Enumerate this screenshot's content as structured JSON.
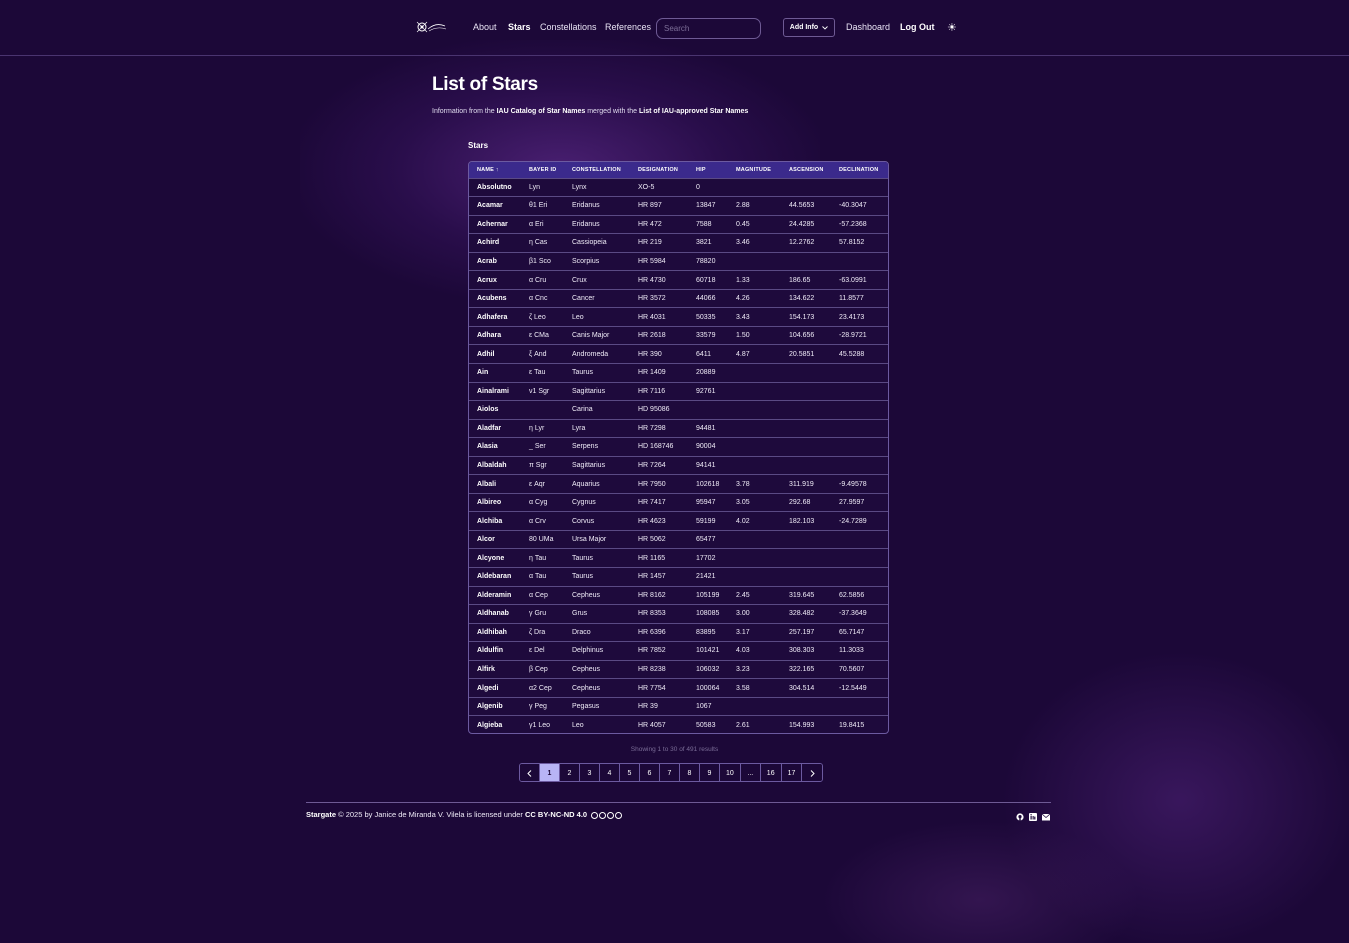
{
  "nav": {
    "logo_text": "Stargate",
    "links": [
      "About",
      "Stars",
      "Constellations",
      "References"
    ],
    "active": "Stars",
    "search_placeholder": "Search",
    "add_info": "Add Info",
    "dashboard": "Dashboard",
    "logout": "Log Out",
    "theme_icon": "sun-icon"
  },
  "page": {
    "title": "List of Stars",
    "info_prefix": "Information from the ",
    "info_source1": "IAU Catalog of Star Names",
    "info_mid": " merged with the ",
    "info_source2": "List of IAU-approved Star Names",
    "section": "Stars"
  },
  "table": {
    "headers": [
      "NAME ↑",
      "BAYER ID",
      "CONSTELLATION",
      "DESIGNATION",
      "HIP",
      "MAGNITUDE",
      "ASCENSION",
      "DECLINATION"
    ],
    "rows": [
      [
        "Absolutno",
        "Lyn",
        "Lynx",
        "XO-5",
        "0",
        "",
        "",
        ""
      ],
      [
        "Acamar",
        "θ1 Eri",
        "Eridanus",
        "HR 897",
        "13847",
        "2.88",
        "44.5653",
        "-40.3047"
      ],
      [
        "Achernar",
        "α Eri",
        "Eridanus",
        "HR 472",
        "7588",
        "0.45",
        "24.4285",
        "-57.2368"
      ],
      [
        "Achird",
        "η Cas",
        "Cassiopeia",
        "HR 219",
        "3821",
        "3.46",
        "12.2762",
        "57.8152"
      ],
      [
        "Acrab",
        "β1 Sco",
        "Scorpius",
        "HR 5984",
        "78820",
        "",
        "",
        ""
      ],
      [
        "Acrux",
        "α Cru",
        "Crux",
        "HR 4730",
        "60718",
        "1.33",
        "186.65",
        "-63.0991"
      ],
      [
        "Acubens",
        "α Cnc",
        "Cancer",
        "HR 3572",
        "44066",
        "4.26",
        "134.622",
        "11.8577"
      ],
      [
        "Adhafera",
        "ζ Leo",
        "Leo",
        "HR 4031",
        "50335",
        "3.43",
        "154.173",
        "23.4173"
      ],
      [
        "Adhara",
        "ε CMa",
        "Canis Major",
        "HR 2618",
        "33579",
        "1.50",
        "104.656",
        "-28.9721"
      ],
      [
        "Adhil",
        "ξ And",
        "Andromeda",
        "HR 390",
        "6411",
        "4.87",
        "20.5851",
        "45.5288"
      ],
      [
        "Ain",
        "ε Tau",
        "Taurus",
        "HR 1409",
        "20889",
        "",
        "",
        ""
      ],
      [
        "Ainalrami",
        "ν1 Sgr",
        "Sagittarius",
        "HR 7116",
        "92761",
        "",
        "",
        ""
      ],
      [
        "Aiolos",
        "",
        "Carina",
        "HD 95086",
        "",
        "",
        "",
        ""
      ],
      [
        "Aladfar",
        "η Lyr",
        "Lyra",
        "HR 7298",
        "94481",
        "",
        "",
        ""
      ],
      [
        "Alasia",
        "_ Ser",
        "Serpens",
        "HD 168746",
        "90004",
        "",
        "",
        ""
      ],
      [
        "Albaldah",
        "π Sgr",
        "Sagittarius",
        "HR 7264",
        "94141",
        "",
        "",
        ""
      ],
      [
        "Albali",
        "ε Aqr",
        "Aquarius",
        "HR 7950",
        "102618",
        "3.78",
        "311.919",
        "-9.49578"
      ],
      [
        "Albireo",
        "α Cyg",
        "Cygnus",
        "HR 7417",
        "95947",
        "3.05",
        "292.68",
        "27.9597"
      ],
      [
        "Alchiba",
        "α Crv",
        "Corvus",
        "HR 4623",
        "59199",
        "4.02",
        "182.103",
        "-24.7289"
      ],
      [
        "Alcor",
        "80 UMa",
        "Ursa Major",
        "HR 5062",
        "65477",
        "",
        "",
        ""
      ],
      [
        "Alcyone",
        "η Tau",
        "Taurus",
        "HR 1165",
        "17702",
        "",
        "",
        ""
      ],
      [
        "Aldebaran",
        "α Tau",
        "Taurus",
        "HR 1457",
        "21421",
        "",
        "",
        ""
      ],
      [
        "Alderamin",
        "α Cep",
        "Cepheus",
        "HR 8162",
        "105199",
        "2.45",
        "319.645",
        "62.5856"
      ],
      [
        "Aldhanab",
        "γ Gru",
        "Grus",
        "HR 8353",
        "108085",
        "3.00",
        "328.482",
        "-37.3649"
      ],
      [
        "Aldhibah",
        "ζ Dra",
        "Draco",
        "HR 6396",
        "83895",
        "3.17",
        "257.197",
        "65.7147"
      ],
      [
        "Aldulfin",
        "ε Del",
        "Delphinus",
        "HR 7852",
        "101421",
        "4.03",
        "308.303",
        "11.3033"
      ],
      [
        "Alfirk",
        "β Cep",
        "Cepheus",
        "HR 8238",
        "106032",
        "3.23",
        "322.165",
        "70.5607"
      ],
      [
        "Algedi",
        "α2 Cep",
        "Cepheus",
        "HR 7754",
        "100064",
        "3.58",
        "304.514",
        "-12.5449"
      ],
      [
        "Algenib",
        "γ Peg",
        "Pegasus",
        "HR 39",
        "1067",
        "",
        "",
        ""
      ],
      [
        "Algieba",
        "γ1 Leo",
        "Leo",
        "HR 4057",
        "50583",
        "2.61",
        "154.993",
        "19.8415"
      ]
    ]
  },
  "pagination": {
    "showing": "Showing 1 to 30 of 491 results",
    "prev_icon": "chevron-left-icon",
    "next_icon": "chevron-right-icon",
    "pages": [
      "1",
      "2",
      "3",
      "4",
      "5",
      "6",
      "7",
      "8",
      "9",
      "10",
      "...",
      "16",
      "17"
    ],
    "active": "1"
  },
  "footer": {
    "brand": "Stargate",
    "text": " © 2025 by Janice de Miranda V. Vilela is licensed under ",
    "license": "CC BY-NC-ND 4.0",
    "icons": [
      "github-icon",
      "linkedin-icon",
      "mail-icon"
    ]
  }
}
